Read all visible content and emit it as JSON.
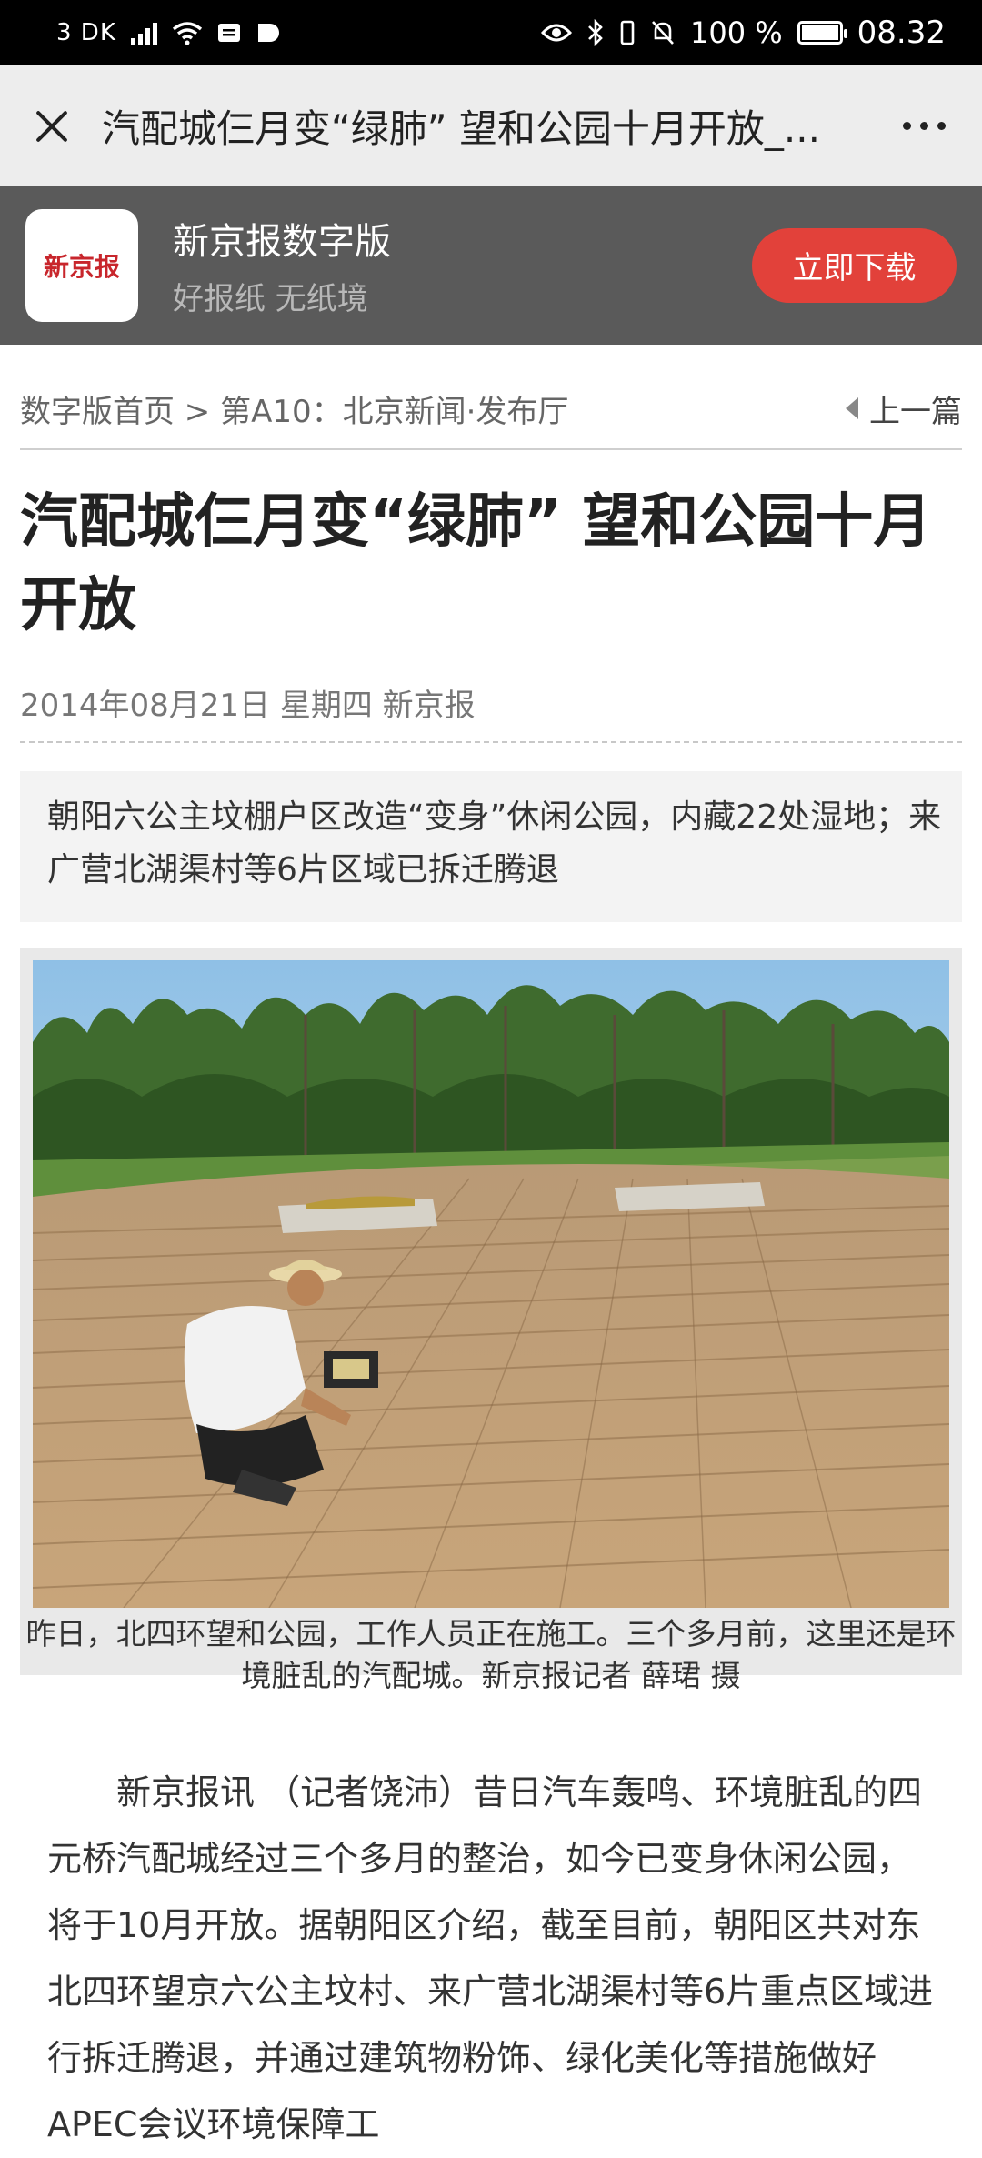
{
  "status_bar": {
    "carrier": "3 DK",
    "battery_percent": "100 %",
    "battery_level": 1.0,
    "time": "08.32"
  },
  "topnav": {
    "title": "汽配城仨月变“绿肺” 望和公园十月开放_..."
  },
  "app_banner": {
    "logo_text": "新京报",
    "app_name": "新京报数字版",
    "slogan": "好报纸 无纸境",
    "download_label": "立即下载",
    "accent_color": "#e2413a"
  },
  "breadcrumb": {
    "path": "数字版首页 > 第A10：北京新闻·发布厅",
    "prev_label": "上一篇"
  },
  "article": {
    "title": "汽配城仨月变“绿肺” 望和公园十月开放",
    "meta": "2014年08月21日 星期四 新京报",
    "subtitle": "朝阳六公主坟棚户区改造“变身”休闲公园，内藏22处湿地；来广营北湖渠村等6片区域已拆迁腾退",
    "photo_caption": "昨日，北四环望和公园，工作人员正在施工。三个多月前，这里还是环境脏乱的汽配城。新京报记者 薛珺 摄",
    "body": "新京报讯 （记者饶沛）昔日汽车轰鸣、环境脏乱的四元桥汽配城经过三个多月的整治，如今已变身休闲公园，将于10月开放。据朝阳区介绍，截至目前，朝阳区共对东北四环望京六公主坟村、来广营北湖渠村等6片重点区域进行拆迁腾退，并通过建筑物粉饰、绿化美化等措施做好APEC会议环境保障工"
  }
}
